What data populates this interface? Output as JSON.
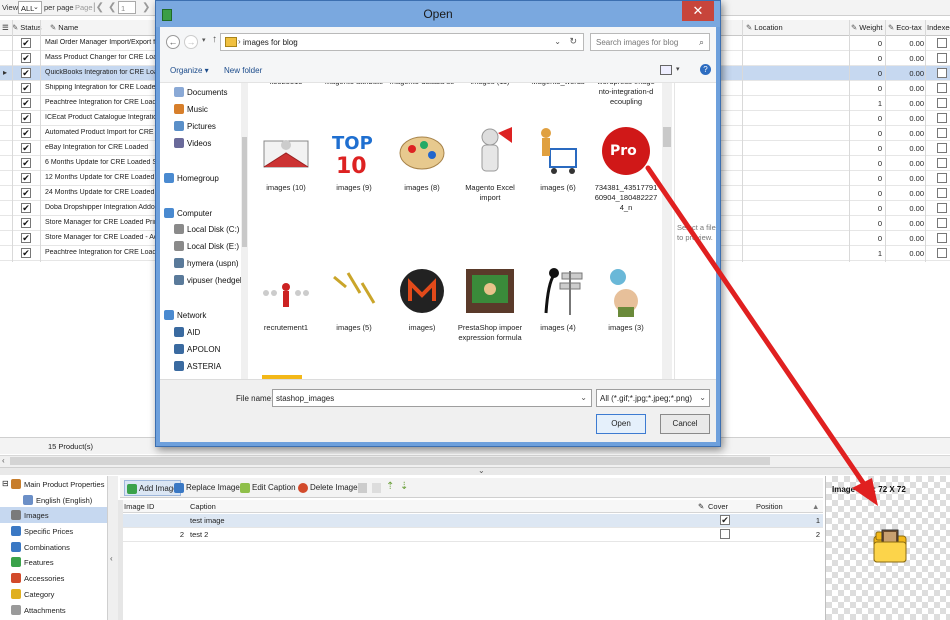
{
  "toolbar": {
    "view_label": "View",
    "view_value": "ALL",
    "per_page_label": "per page",
    "page_label": "Page",
    "page_value": "1"
  },
  "grid": {
    "headers": {
      "status": "Status",
      "name": "Name",
      "location": "Location",
      "weight": "Weight",
      "ecotax": "Eco-tax",
      "indexed": "Indexed"
    },
    "rows": [
      {
        "name": "Mail Order Manager Import/Export fo",
        "weight": "0",
        "eco": "0.00",
        "selected": false
      },
      {
        "name": "Mass Product Changer for CRE Loade",
        "weight": "0",
        "eco": "0.00",
        "selected": false
      },
      {
        "name": "QuickBooks Integration for CRE Load",
        "weight": "0",
        "eco": "0.00",
        "selected": true
      },
      {
        "name": "Shipping Integration for CRE Loaded",
        "weight": "0",
        "eco": "0.00",
        "selected": false
      },
      {
        "name": "Peachtree Integration for CRE Loade",
        "weight": "1",
        "eco": "0.00",
        "selected": false
      },
      {
        "name": "ICEcat Product Catalogue Integratio",
        "weight": "0",
        "eco": "0.00",
        "selected": false
      },
      {
        "name": "Automated Product Import for CRE L",
        "weight": "0",
        "eco": "0.00",
        "selected": false
      },
      {
        "name": "eBay Integration for CRE Loaded",
        "weight": "0",
        "eco": "0.00",
        "selected": false
      },
      {
        "name": "6 Months Update for CRE Loaded Sto",
        "weight": "0",
        "eco": "0.00",
        "selected": false
      },
      {
        "name": "12 Months Update for CRE Loaded S",
        "weight": "0",
        "eco": "0.00",
        "selected": false
      },
      {
        "name": "24 Months Update for CRE Loaded S",
        "weight": "0",
        "eco": "0.00",
        "selected": false
      },
      {
        "name": "Doba Dropshipper Integration Addor",
        "weight": "0",
        "eco": "0.00",
        "selected": false
      },
      {
        "name": "Store Manager for CRE Loaded  Prim",
        "weight": "0",
        "eco": "0.00",
        "selected": false
      },
      {
        "name": "Store Manager for CRE Loaded - Add",
        "weight": "0",
        "eco": "0.00",
        "selected": false
      },
      {
        "name": "Peachtree Integration for CRE Loade",
        "weight": "1",
        "eco": "0.00",
        "selected": false
      }
    ],
    "count_text": "15 Product(s)"
  },
  "tree": {
    "items": [
      {
        "label": "Main Product Properties",
        "color": "#c77d2b"
      },
      {
        "label": "English (English)",
        "color": "#6b8fc7"
      },
      {
        "label": "Images",
        "color": "#7a7a7a"
      },
      {
        "label": "Specific Prices",
        "color": "#3a78c4"
      },
      {
        "label": "Combinations",
        "color": "#3a78c4"
      },
      {
        "label": "Features",
        "color": "#3aa24a"
      },
      {
        "label": "Accessories",
        "color": "#d24a2b"
      },
      {
        "label": "Category",
        "color": "#e0b020"
      },
      {
        "label": "Attachments",
        "color": "#9a9a9a"
      }
    ],
    "selected_index": 2
  },
  "images_panel": {
    "buttons": {
      "add": "Add Image",
      "replace": "Replace Image",
      "edit": "Edit Caption",
      "delete": "Delete Image"
    },
    "headers": {
      "id": "Image ID",
      "caption": "Caption",
      "cover": "Cover",
      "position": "Position"
    },
    "rows": [
      {
        "id": "",
        "caption": "test image",
        "cover": true,
        "position": "1"
      },
      {
        "id": "2",
        "caption": "test 2",
        "cover": false,
        "position": "2"
      }
    ]
  },
  "preview": {
    "label": "Image Size: 72 X 72"
  },
  "dialog": {
    "title": "Open",
    "close_symbol": "✕",
    "address_path": "images for blog",
    "search_placeholder": "Search images for blog",
    "organize": "Organize ▾",
    "new_folder": "New folder",
    "nav": [
      "Documents",
      "Music",
      "Pictures",
      "Videos",
      "Homegroup",
      "Computer",
      "Local Disk (C:)",
      "Local Disk (E:)",
      "hymera (uspn)",
      "vipuser (hedgeho",
      "Network",
      "AID",
      "APOLON",
      "ASTERIA"
    ],
    "files_top_partial": [
      "k5825515",
      "Magento attribute",
      "magento-databa se",
      "images (11)",
      "Magento_words",
      "wordpress-image nto-integration-d ecoupling"
    ],
    "files_row1": [
      "images (10)",
      "images (9)",
      "images (8)",
      "Magento Excel import",
      "images (6)",
      "734381_43517791 60904_180482227 4_n"
    ],
    "files_row2": [
      "recrutement1",
      "images (5)",
      "images)",
      "PrestaShop impoer expression formula",
      "images (4)",
      "images (3)"
    ],
    "preview_message": "Select a file to preview.",
    "filename_label": "File name:",
    "filename_value": "stashop_images",
    "filetype_value": "All (*.gif;*.jpg;*.jpeg;*.png)",
    "open_button": "Open",
    "cancel_button": "Cancel"
  },
  "colors": {
    "dialog_frame": "#6ea0dc",
    "close_red": "#c7453b",
    "selection": "#c6d8f0",
    "arrow_red": "#e02020"
  }
}
